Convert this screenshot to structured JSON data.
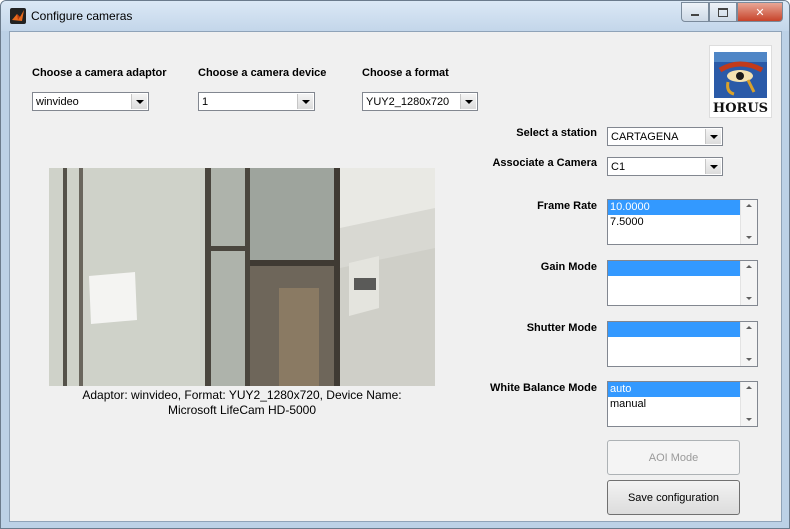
{
  "window": {
    "title": "Configure cameras",
    "icon": "matlab-icon",
    "controls": [
      "minimize-icon",
      "maximize-icon",
      "close-icon"
    ]
  },
  "adaptor": {
    "label": "Choose a camera adaptor",
    "value": "winvideo"
  },
  "device": {
    "label": "Choose a camera device",
    "value": "1"
  },
  "format": {
    "label": "Choose a format",
    "value": "YUY2_1280x720"
  },
  "logo": {
    "text": "HORUS"
  },
  "station": {
    "label": "Select a station",
    "value": "CARTAGENA"
  },
  "camera": {
    "label": "Associate a Camera",
    "value": "C1"
  },
  "frame_rate": {
    "label": "Frame Rate",
    "items": [
      "10.0000",
      "7.5000"
    ],
    "selected": 0
  },
  "gain_mode": {
    "label": "Gain Mode",
    "items": [
      ""
    ],
    "selected": 0
  },
  "shutter_mode": {
    "label": "Shutter Mode",
    "items": [
      ""
    ],
    "selected": 0
  },
  "white_balance": {
    "label": "White Balance Mode",
    "items": [
      "auto",
      "manual"
    ],
    "selected": 0
  },
  "buttons": {
    "aoi": "AOI Mode",
    "save": "Save configuration"
  },
  "preview": {
    "caption_line1": "Adaptor: winvideo, Format: YUY2_1280x720, Device Name:",
    "caption_line2": "Microsoft LifeCam HD-5000"
  },
  "colors": {
    "selection": "#3399ff",
    "client_bg": "#f0f0f0"
  }
}
